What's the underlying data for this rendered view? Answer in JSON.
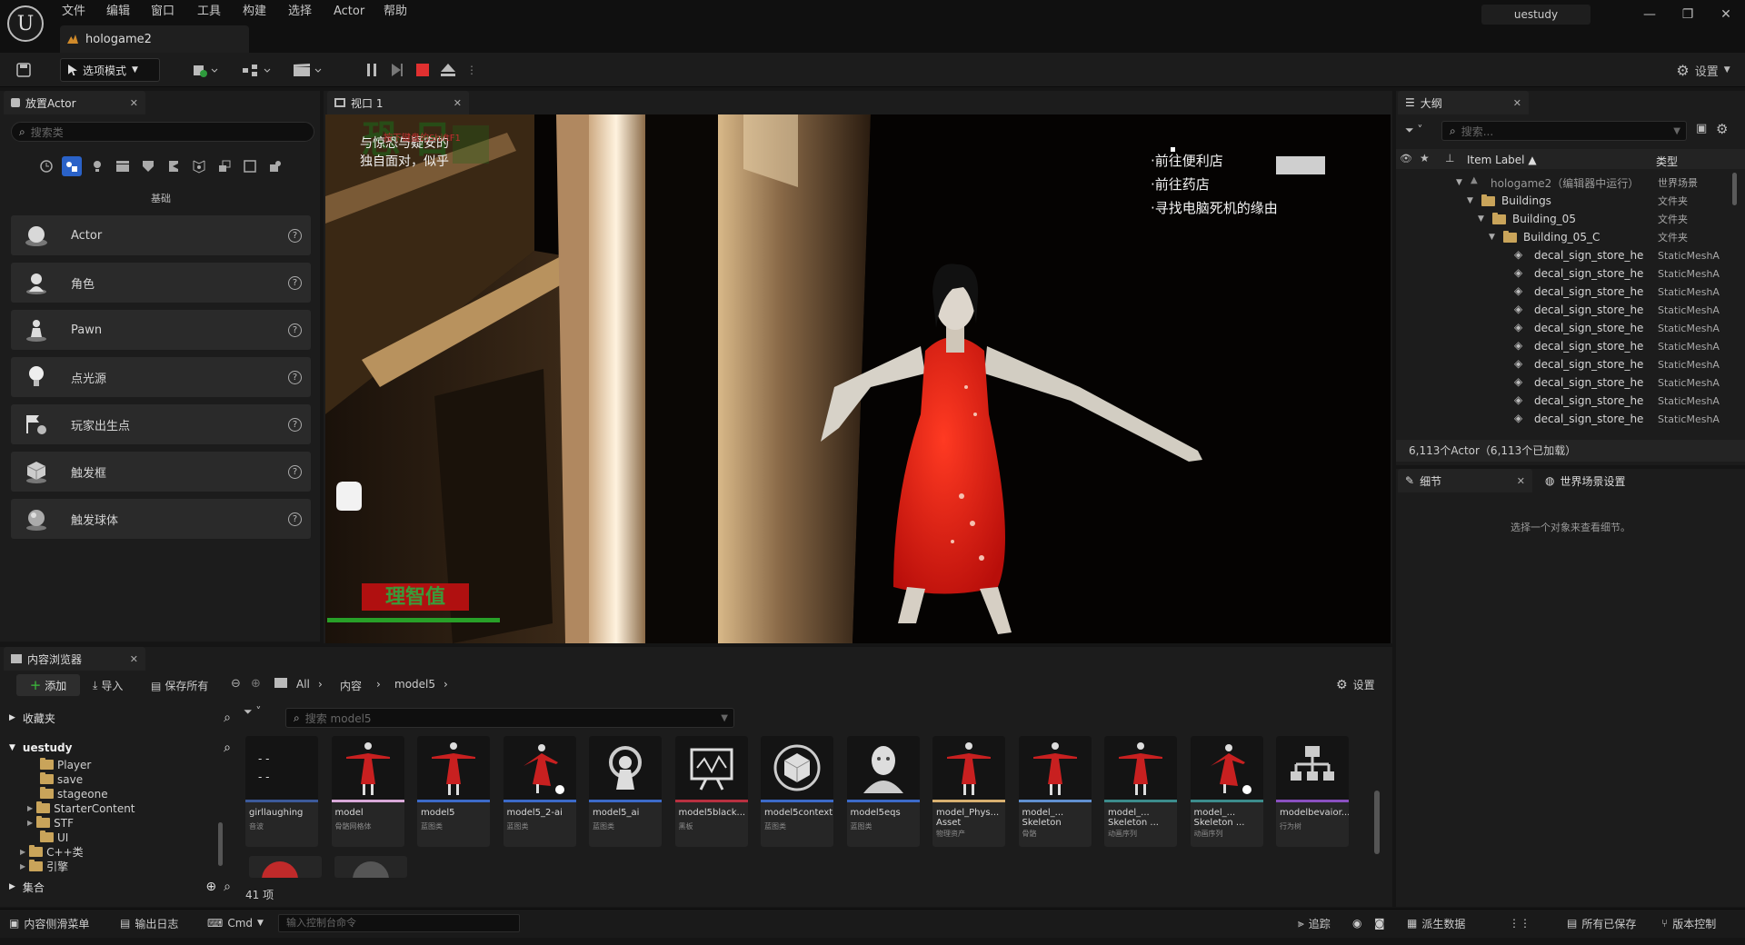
{
  "app": {
    "project_tab": "hologame2",
    "user": "uestudy",
    "menu": [
      "文件",
      "编辑",
      "窗口",
      "工具",
      "构建",
      "选择",
      "Actor",
      "帮助"
    ]
  },
  "toolbar": {
    "mode": "选项模式",
    "settings": "设置"
  },
  "place_actor": {
    "tab": "放置Actor",
    "search_placeholder": "搜索类",
    "category_label": "基础",
    "items": [
      {
        "label": "Actor",
        "icon": "sphere-icon"
      },
      {
        "label": "角色",
        "icon": "character-icon"
      },
      {
        "label": "Pawn",
        "icon": "pawn-icon"
      },
      {
        "label": "点光源",
        "icon": "light-bulb-icon"
      },
      {
        "label": "玩家出生点",
        "icon": "player-start-icon"
      },
      {
        "label": "触发框",
        "icon": "trigger-box-icon"
      },
      {
        "label": "触发球体",
        "icon": "trigger-sphere-icon"
      }
    ]
  },
  "viewport": {
    "tab": "视口 1",
    "hud_lines": [
      "与惊恐与疑安的",
      "独自面对，似乎"
    ],
    "hud_small": "按下键盘的ShiftF1",
    "objectives": [
      "·前往便利店",
      "·前往药店",
      "·寻找电脑死机的缘由"
    ],
    "sanity_label": "理智值"
  },
  "outliner": {
    "tab": "大纲",
    "search_placeholder": "搜索...",
    "col_label": "Item Label ▲",
    "col_type": "类型",
    "rows": [
      {
        "label": "hologame2（编辑器中运行）",
        "type": "世界场景",
        "indent": 0,
        "kind": "world"
      },
      {
        "label": "Buildings",
        "type": "文件夹",
        "indent": 1,
        "kind": "folder"
      },
      {
        "label": "Building_05",
        "type": "文件夹",
        "indent": 2,
        "kind": "folder"
      },
      {
        "label": "Building_05_C",
        "type": "文件夹",
        "indent": 3,
        "kind": "folder"
      },
      {
        "label": "decal_sign_store_he",
        "type": "StaticMeshA",
        "indent": 4,
        "kind": "mesh"
      },
      {
        "label": "decal_sign_store_he",
        "type": "StaticMeshA",
        "indent": 4,
        "kind": "mesh"
      },
      {
        "label": "decal_sign_store_he",
        "type": "StaticMeshA",
        "indent": 4,
        "kind": "mesh"
      },
      {
        "label": "decal_sign_store_he",
        "type": "StaticMeshA",
        "indent": 4,
        "kind": "mesh"
      },
      {
        "label": "decal_sign_store_he",
        "type": "StaticMeshA",
        "indent": 4,
        "kind": "mesh"
      },
      {
        "label": "decal_sign_store_he",
        "type": "StaticMeshA",
        "indent": 4,
        "kind": "mesh"
      },
      {
        "label": "decal_sign_store_he",
        "type": "StaticMeshA",
        "indent": 4,
        "kind": "mesh"
      },
      {
        "label": "decal_sign_store_he",
        "type": "StaticMeshA",
        "indent": 4,
        "kind": "mesh"
      },
      {
        "label": "decal_sign_store_he",
        "type": "StaticMeshA",
        "indent": 4,
        "kind": "mesh"
      },
      {
        "label": "decal_sign_store_he",
        "type": "StaticMeshA",
        "indent": 4,
        "kind": "mesh"
      }
    ],
    "count": "6,113个Actor（6,113个已加载）"
  },
  "details": {
    "tab": "细节",
    "world_tab": "世界场景设置",
    "hint": "选择一个对象来查看细节。"
  },
  "content_browser": {
    "tab": "内容浏览器",
    "add": "添加",
    "import": "导入",
    "save_all": "保存所有",
    "path": [
      "All",
      "内容",
      "model5"
    ],
    "settings": "设置",
    "favorites": "收藏夹",
    "root": "uestudy",
    "search_placeholder": "搜索 model5",
    "tree": [
      {
        "label": "Player",
        "indent": 0
      },
      {
        "label": "save",
        "indent": 0
      },
      {
        "label": "stageone",
        "indent": 0
      },
      {
        "label": "StarterContent",
        "indent": 0
      },
      {
        "label": "STF",
        "indent": 0
      },
      {
        "label": "UI",
        "indent": 0
      },
      {
        "label": "C++类",
        "indent": -1
      },
      {
        "label": "引擎",
        "indent": -1
      }
    ],
    "collections": "集合",
    "item_count": "41 项",
    "assets": [
      {
        "name": "girllaughing",
        "type": "音波",
        "color": "#3c5a9a",
        "thumb": "dark"
      },
      {
        "name": "model",
        "type": "骨骼网格体",
        "color": "#d8a8d8",
        "thumb": "figure"
      },
      {
        "name": "model5",
        "type": "蓝图类",
        "color": "#3c6ac8",
        "thumb": "figure"
      },
      {
        "name": "model5_2-ai",
        "type": "蓝图类",
        "color": "#3c6ac8",
        "thumb": "figure-lean"
      },
      {
        "name": "model5_ai",
        "type": "蓝图类",
        "color": "#3c6ac8",
        "thumb": "ai"
      },
      {
        "name": "model5black...",
        "type": "黑板",
        "color": "#b83040",
        "thumb": "board"
      },
      {
        "name": "model5context",
        "type": "蓝图类",
        "color": "#3c6ac8",
        "thumb": "cube"
      },
      {
        "name": "model5eqs",
        "type": "蓝图类",
        "color": "#3c6ac8",
        "thumb": "head"
      },
      {
        "name": "model_Phys...",
        "name2": "Asset",
        "type": "物理资产",
        "color": "#d8b070",
        "thumb": "figure"
      },
      {
        "name": "model_...",
        "name2": "Skeleton",
        "type": "骨骼",
        "color": "#6090d0",
        "thumb": "figure"
      },
      {
        "name": "model_...",
        "name2": "Skeleton ...",
        "type": "动画序列",
        "color": "#3c8c8c",
        "thumb": "figure"
      },
      {
        "name": "model_...",
        "name2": "Skeleton ...",
        "type": "动画序列",
        "color": "#3c8c8c",
        "thumb": "figure-lean"
      },
      {
        "name": "modelbevaior...",
        "type": "行为树",
        "color": "#8a50c0",
        "thumb": "tree"
      }
    ]
  },
  "statusbar": {
    "drawer": "内容侧滑菜单",
    "log": "输出日志",
    "cmd": "Cmd",
    "console_placeholder": "输入控制台命令",
    "trace": "追踪",
    "derived": "派生数据",
    "saved": "所有已保存",
    "vcs": "版本控制"
  }
}
